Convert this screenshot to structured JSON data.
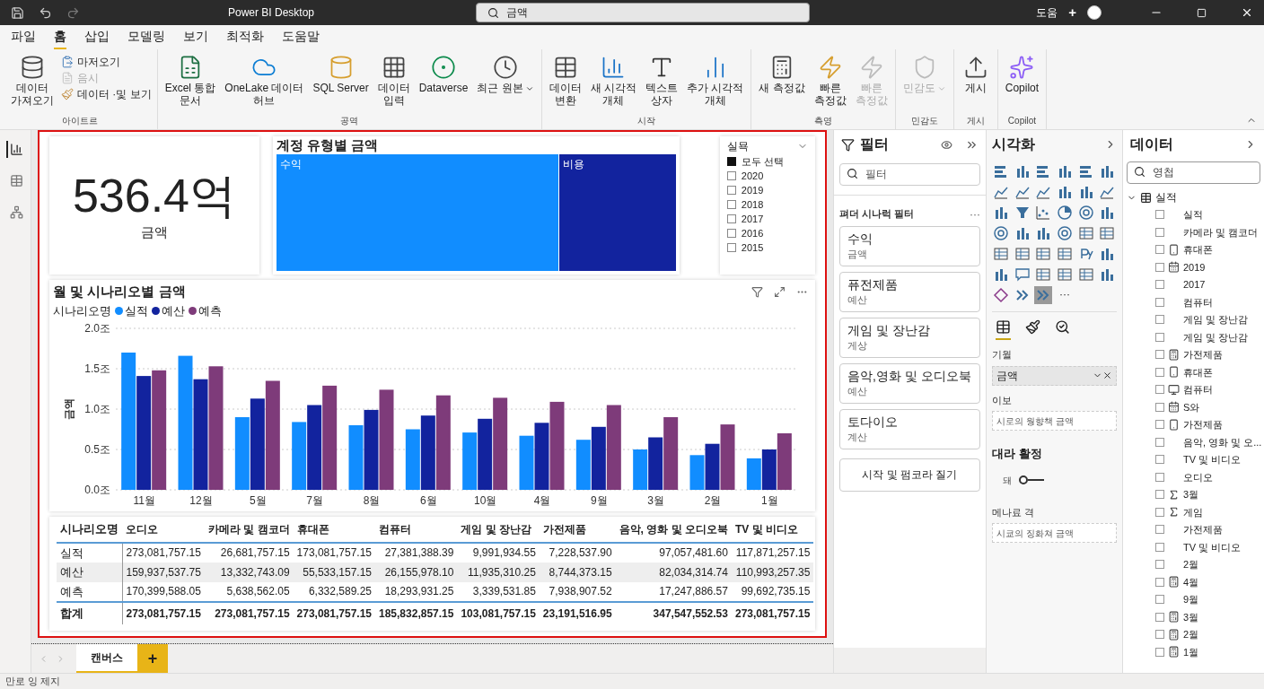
{
  "window": {
    "title": "Power BI Desktop",
    "search": "금액",
    "help": "도움",
    "plus": "+"
  },
  "menu": [
    {
      "label": "파일",
      "selected": false
    },
    {
      "label": "홈",
      "selected": true
    },
    {
      "label": "삽입",
      "selected": false
    },
    {
      "label": "모델링",
      "selected": false
    },
    {
      "label": "보기",
      "selected": false
    },
    {
      "label": "최적화",
      "selected": false
    },
    {
      "label": "도움말",
      "selected": false
    }
  ],
  "ribbon": [
    {
      "label": "아이트르",
      "items": [
        {
          "kind": "large",
          "label": "데이터\n가져오기",
          "disabled": false
        },
        {
          "kind": "small",
          "label": "마저오기",
          "disabled": false
        },
        {
          "kind": "small",
          "label": "음시",
          "disabled": true
        },
        {
          "kind": "small",
          "label": "데이터 ·및 보기",
          "disabled": false
        }
      ]
    },
    {
      "label": "공역",
      "items": [
        {
          "kind": "large",
          "label": "Excel 통합\n문서",
          "disabled": false
        },
        {
          "kind": "large",
          "label": "OneLake 데이터\n허브",
          "disabled": false
        },
        {
          "kind": "large",
          "label": "SQL Server",
          "disabled": false
        },
        {
          "kind": "large",
          "label": "데이터\n입력",
          "disabled": false
        },
        {
          "kind": "large",
          "label": "Dataverse",
          "disabled": false
        },
        {
          "kind": "large",
          "label": "최근 원본",
          "disabled": false,
          "dropdown": true
        }
      ]
    },
    {
      "label": "시작",
      "items": [
        {
          "kind": "large",
          "label": "데이터\n변환",
          "disabled": false
        },
        {
          "kind": "large",
          "label": "새 시각적\n개체",
          "disabled": false
        },
        {
          "kind": "large",
          "label": "텍스트\n상자",
          "disabled": false
        },
        {
          "kind": "large",
          "label": "추가 시각적\n개체",
          "disabled": false
        }
      ]
    },
    {
      "label": "측영",
      "items": [
        {
          "kind": "large",
          "label": "새 측정값",
          "disabled": false
        },
        {
          "kind": "large",
          "label": "빠른\n측정값",
          "disabled": false
        },
        {
          "kind": "large",
          "label": "빠른\n측정값",
          "disabled": true
        }
      ]
    },
    {
      "label": "민감도",
      "items": [
        {
          "kind": "large",
          "label": "민감도",
          "disabled": true,
          "dropdown": true
        }
      ]
    },
    {
      "label": "게시",
      "items": [
        {
          "kind": "large",
          "label": "게시",
          "disabled": false
        }
      ]
    },
    {
      "label": "Copilot",
      "items": [
        {
          "kind": "large",
          "label": "Copilot",
          "disabled": false
        }
      ]
    }
  ],
  "rail": [
    {
      "selected": true
    },
    {
      "selected": false
    },
    {
      "selected": false
    }
  ],
  "card": {
    "value": "536.4억",
    "label": "금액"
  },
  "treemap": {
    "title": "계정 유형별 금액",
    "items": [
      {
        "label": "수익",
        "color": "#118dff"
      },
      {
        "label": "비용",
        "color": "#12239e"
      }
    ]
  },
  "slicer": {
    "title": "실묙",
    "items": [
      {
        "label": "모두 선택",
        "checked": true
      },
      {
        "label": "2020",
        "checked": false
      },
      {
        "label": "2019",
        "checked": false
      },
      {
        "label": "2018",
        "checked": false
      },
      {
        "label": "2017",
        "checked": false
      },
      {
        "label": "2016",
        "checked": false
      },
      {
        "label": "2015",
        "checked": false
      }
    ]
  },
  "bar_chart": {
    "legend_title": "시나리오명",
    "chart_data": {
      "type": "bar",
      "title": "월 및 시나리오별 금액",
      "ylabel": "금액",
      "grid": true,
      "categories": [
        "11월",
        "12월",
        "5월",
        "7월",
        "8월",
        "6월",
        "10월",
        "4월",
        "9월",
        "3월",
        "2월",
        "1월"
      ],
      "series": [
        {
          "name": "실적",
          "color": "#118dff",
          "values": [
            1.7,
            1.66,
            0.9,
            0.84,
            0.8,
            0.75,
            0.71,
            0.67,
            0.62,
            0.5,
            0.43,
            0.39
          ]
        },
        {
          "name": "예산",
          "color": "#12239e",
          "values": [
            1.41,
            1.37,
            1.13,
            1.05,
            0.99,
            0.92,
            0.88,
            0.83,
            0.78,
            0.65,
            0.57,
            0.5
          ]
        },
        {
          "name": "예측",
          "color": "#7e3b7a",
          "values": [
            1.48,
            1.53,
            1.35,
            1.29,
            1.24,
            1.17,
            1.14,
            1.09,
            1.05,
            0.9,
            0.81,
            0.7
          ]
        }
      ],
      "ylim": [
        0,
        2
      ],
      "yticks": [
        {
          "value": 0,
          "label": "0.0조"
        },
        {
          "value": 0.5,
          "label": "0.5조"
        },
        {
          "value": 1,
          "label": "1.0조"
        },
        {
          "value": 1.5,
          "label": "1.5조"
        },
        {
          "value": 2,
          "label": "2.0조"
        }
      ]
    }
  },
  "table": {
    "columns": [
      "시나리오명",
      "오디오",
      "카메라 및 캠코더",
      "휴대폰",
      "컴퓨터",
      "게임 및 장난감",
      "가전제품",
      "음악, 영화 및 오디오북",
      "TV 및 비디오"
    ],
    "rows": [
      [
        "실적",
        "273,081,757.15",
        "26,681,757.15",
        "173,081,757.15",
        "27,381,388.39",
        "9,991,934.55",
        "7,228,537.90",
        "97,057,481.60",
        "117,871,257.15"
      ],
      [
        "예산",
        "159,937,537.75",
        "13,332,743.09",
        "55,533,157.15",
        "26,155,978.10",
        "11,935,310.25",
        "8,744,373.15",
        "82,034,314.74",
        "110,993,257.35"
      ],
      [
        "예측",
        "170,399,588.05",
        "5,638,562.05",
        "6,332,589.25",
        "18,293,931.25",
        "3,339,531.85",
        "7,938,907.52",
        "17,247,886.57",
        "99,692,735.15"
      ]
    ],
    "total": [
      "합계",
      "273,081,757.15",
      "273,081,757.15",
      "273,081,757.15",
      "185,832,857.15",
      "103,081,757.15",
      "23,191,516.95",
      "347,547,552.53",
      "273,081,757.15"
    ]
  },
  "page_tabs": [
    {
      "label": "캔버스",
      "selected": true
    }
  ],
  "add_page": "+",
  "status_bar": "만로 잉 제지",
  "filters": {
    "title": "필터",
    "search_placeholder": "필터",
    "section": "펴더 시나럭 필터",
    "more": "···",
    "cards": [
      {
        "title": "수익",
        "value": "금액"
      },
      {
        "title": "퓨전제품",
        "value": "예산"
      },
      {
        "title": "게임 및 장난감",
        "value": "게상"
      },
      {
        "title": "음악,영화 및 오디오북",
        "value": "예산"
      },
      {
        "title": "토다이오",
        "value": "계산"
      }
    ],
    "button": "시작 및 펌코라 질기"
  },
  "visualizations": {
    "title": "시각화",
    "types": [
      {
        "selected": false
      },
      {
        "selected": false
      },
      {
        "selected": false
      },
      {
        "selected": false
      },
      {
        "selected": false
      },
      {
        "selected": false
      },
      {
        "selected": false
      },
      {
        "selected": false
      },
      {
        "selected": false
      },
      {
        "selected": false
      },
      {
        "selected": false
      },
      {
        "selected": false
      },
      {
        "selected": false
      },
      {
        "selected": false
      },
      {
        "selected": false
      },
      {
        "selected": false
      },
      {
        "selected": false
      },
      {
        "selected": false
      },
      {
        "selected": false
      },
      {
        "selected": false
      },
      {
        "selected": false
      },
      {
        "selected": false
      },
      {
        "selected": false
      },
      {
        "selected": false
      },
      {
        "selected": false
      },
      {
        "selected": false
      },
      {
        "selected": false
      },
      {
        "selected": false
      },
      {
        "selected": false
      },
      {
        "selected": false
      },
      {
        "selected": false
      },
      {
        "selected": false
      },
      {
        "selected": false
      },
      {
        "selected": false
      },
      {
        "selected": false
      },
      {
        "selected": false
      },
      {
        "selected": false
      },
      {
        "selected": false
      },
      {
        "selected": true
      }
    ],
    "more": "···",
    "tabs": [
      {
        "selected": true
      },
      {
        "selected": false
      },
      {
        "selected": false
      }
    ],
    "wells": [
      {
        "label": "기월",
        "value": "금액"
      },
      {
        "label": "이보",
        "placeholder": "시로의 웡향책 금액"
      }
    ],
    "drill_title": "대라 활정",
    "toggle_label": "돼",
    "toggle_on": false,
    "wells2": [
      {
        "label": "메나료 격",
        "placeholder": "시쿄의 징화쳐 금액"
      }
    ]
  },
  "data": {
    "title": "데이터",
    "search_placeholder": "영첩",
    "tree": [
      {
        "label": "실적",
        "expanded": true,
        "children": [
          {
            "label": "실적",
            "kind": "plain",
            "checked": false
          },
          {
            "label": "카메라 및 캠코더",
            "kind": "plain",
            "checked": false
          },
          {
            "label": "휴대폰",
            "kind": "phone",
            "checked": false
          },
          {
            "label": "2019",
            "kind": "calendar",
            "checked": false
          },
          {
            "label": "2017",
            "kind": "plain",
            "checked": false
          },
          {
            "label": "컴퓨터",
            "kind": "plain",
            "checked": false
          },
          {
            "label": "게임 및 장난감",
            "kind": "plain",
            "checked": false
          },
          {
            "label": "게임 및 장난감",
            "kind": "plain",
            "checked": false
          },
          {
            "label": "가전제품",
            "kind": "calc",
            "checked": false
          },
          {
            "label": "휴대폰",
            "kind": "phone",
            "checked": false
          },
          {
            "label": "컴퓨터",
            "kind": "screen",
            "checked": false
          },
          {
            "label": "S와",
            "kind": "calendar",
            "checked": false
          },
          {
            "label": "가전제품",
            "kind": "phone",
            "checked": false
          },
          {
            "label": "음악, 영화 및 오...",
            "kind": "plain",
            "checked": false
          },
          {
            "label": "TV 및 비디오",
            "kind": "plain",
            "checked": false
          },
          {
            "label": "오디오",
            "kind": "plain",
            "checked": false
          },
          {
            "label": "3월",
            "kind": "sigma",
            "checked": false
          },
          {
            "label": "게임",
            "kind": "sigma",
            "checked": false
          },
          {
            "label": "가전제품",
            "kind": "plain",
            "checked": false
          },
          {
            "label": "TV 및 비디오",
            "kind": "plain",
            "checked": false
          },
          {
            "label": "2월",
            "kind": "plain",
            "checked": false
          },
          {
            "label": "4월",
            "kind": "calc",
            "checked": false
          },
          {
            "label": "9월",
            "kind": "plain",
            "checked": false
          },
          {
            "label": "3월",
            "kind": "calc",
            "checked": false
          },
          {
            "label": "2월",
            "kind": "calc",
            "checked": false
          },
          {
            "label": "1월",
            "kind": "calc",
            "checked": false
          }
        ]
      }
    ]
  }
}
